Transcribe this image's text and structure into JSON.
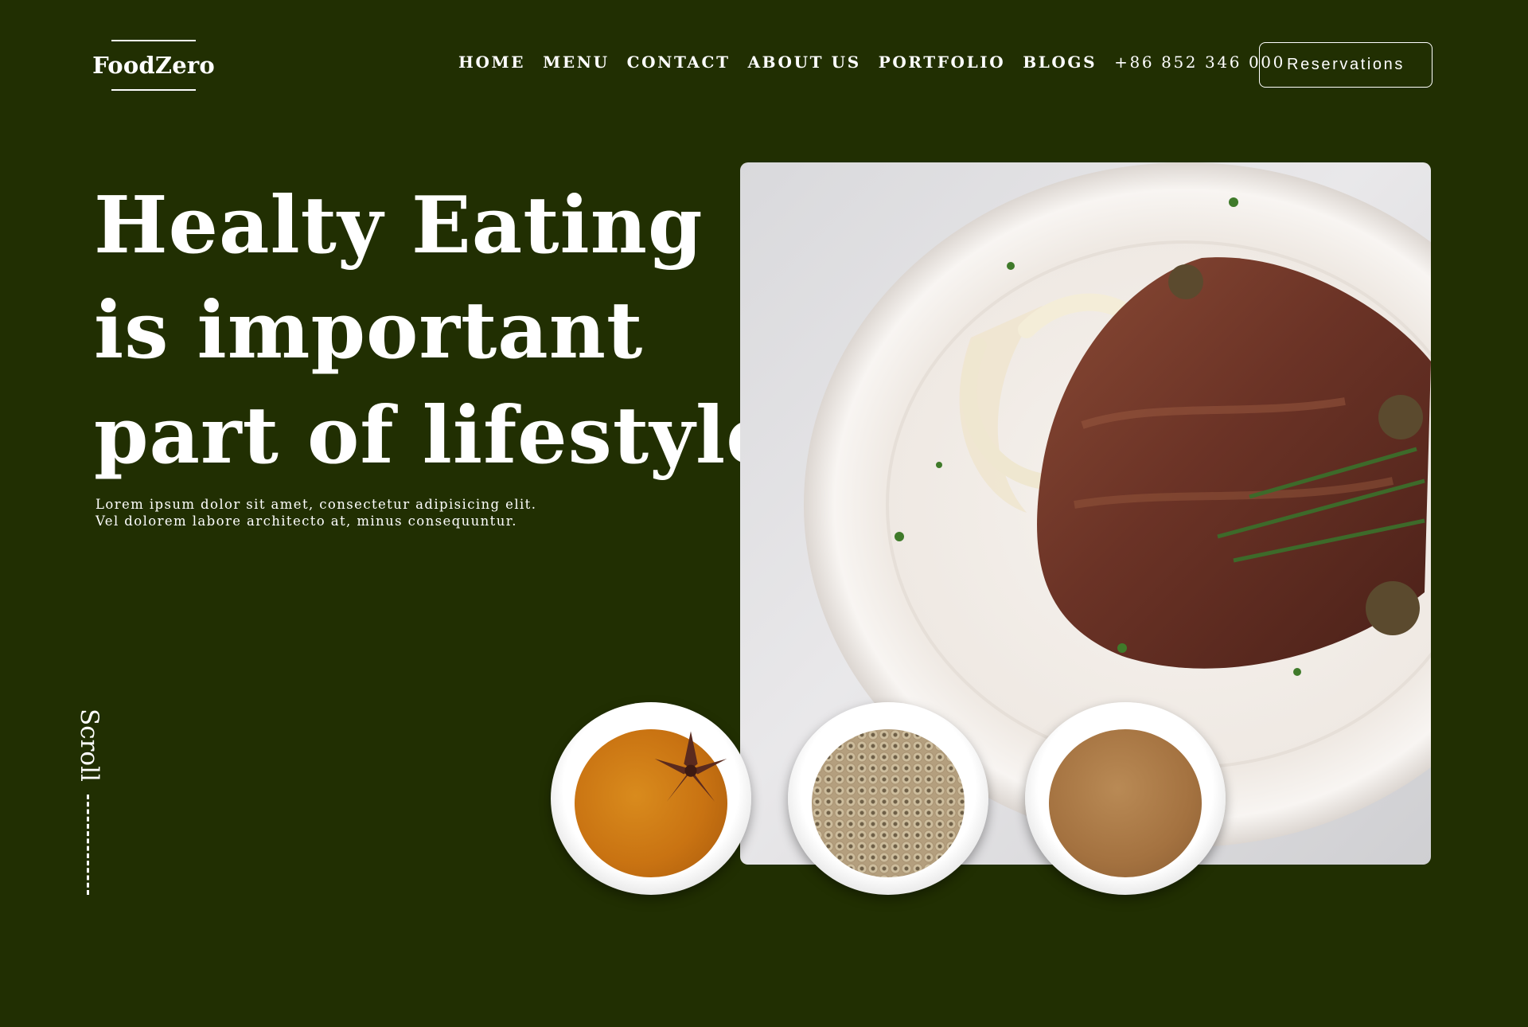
{
  "header": {
    "logo": "FoodZero",
    "nav": [
      {
        "label": "HOME"
      },
      {
        "label": "MENU"
      },
      {
        "label": "CONTACT"
      },
      {
        "label": "ABOUT US"
      },
      {
        "label": "PORTFOLIO"
      },
      {
        "label": "BLOGS"
      }
    ],
    "phone": "+86 852 346 000",
    "reservations_label": "Reservations"
  },
  "hero": {
    "title_lines": [
      "Healty Eating",
      "is important",
      "part of lifestyle"
    ],
    "description_lines": [
      "Lorem ipsum dolor sit amet, consectetur adipisicing elit.",
      "Vel dolorem labore architecto at, minus consequuntur."
    ]
  },
  "scroll_label": "Scroll",
  "colors": {
    "background": "#212f02",
    "text": "#ffffff"
  }
}
